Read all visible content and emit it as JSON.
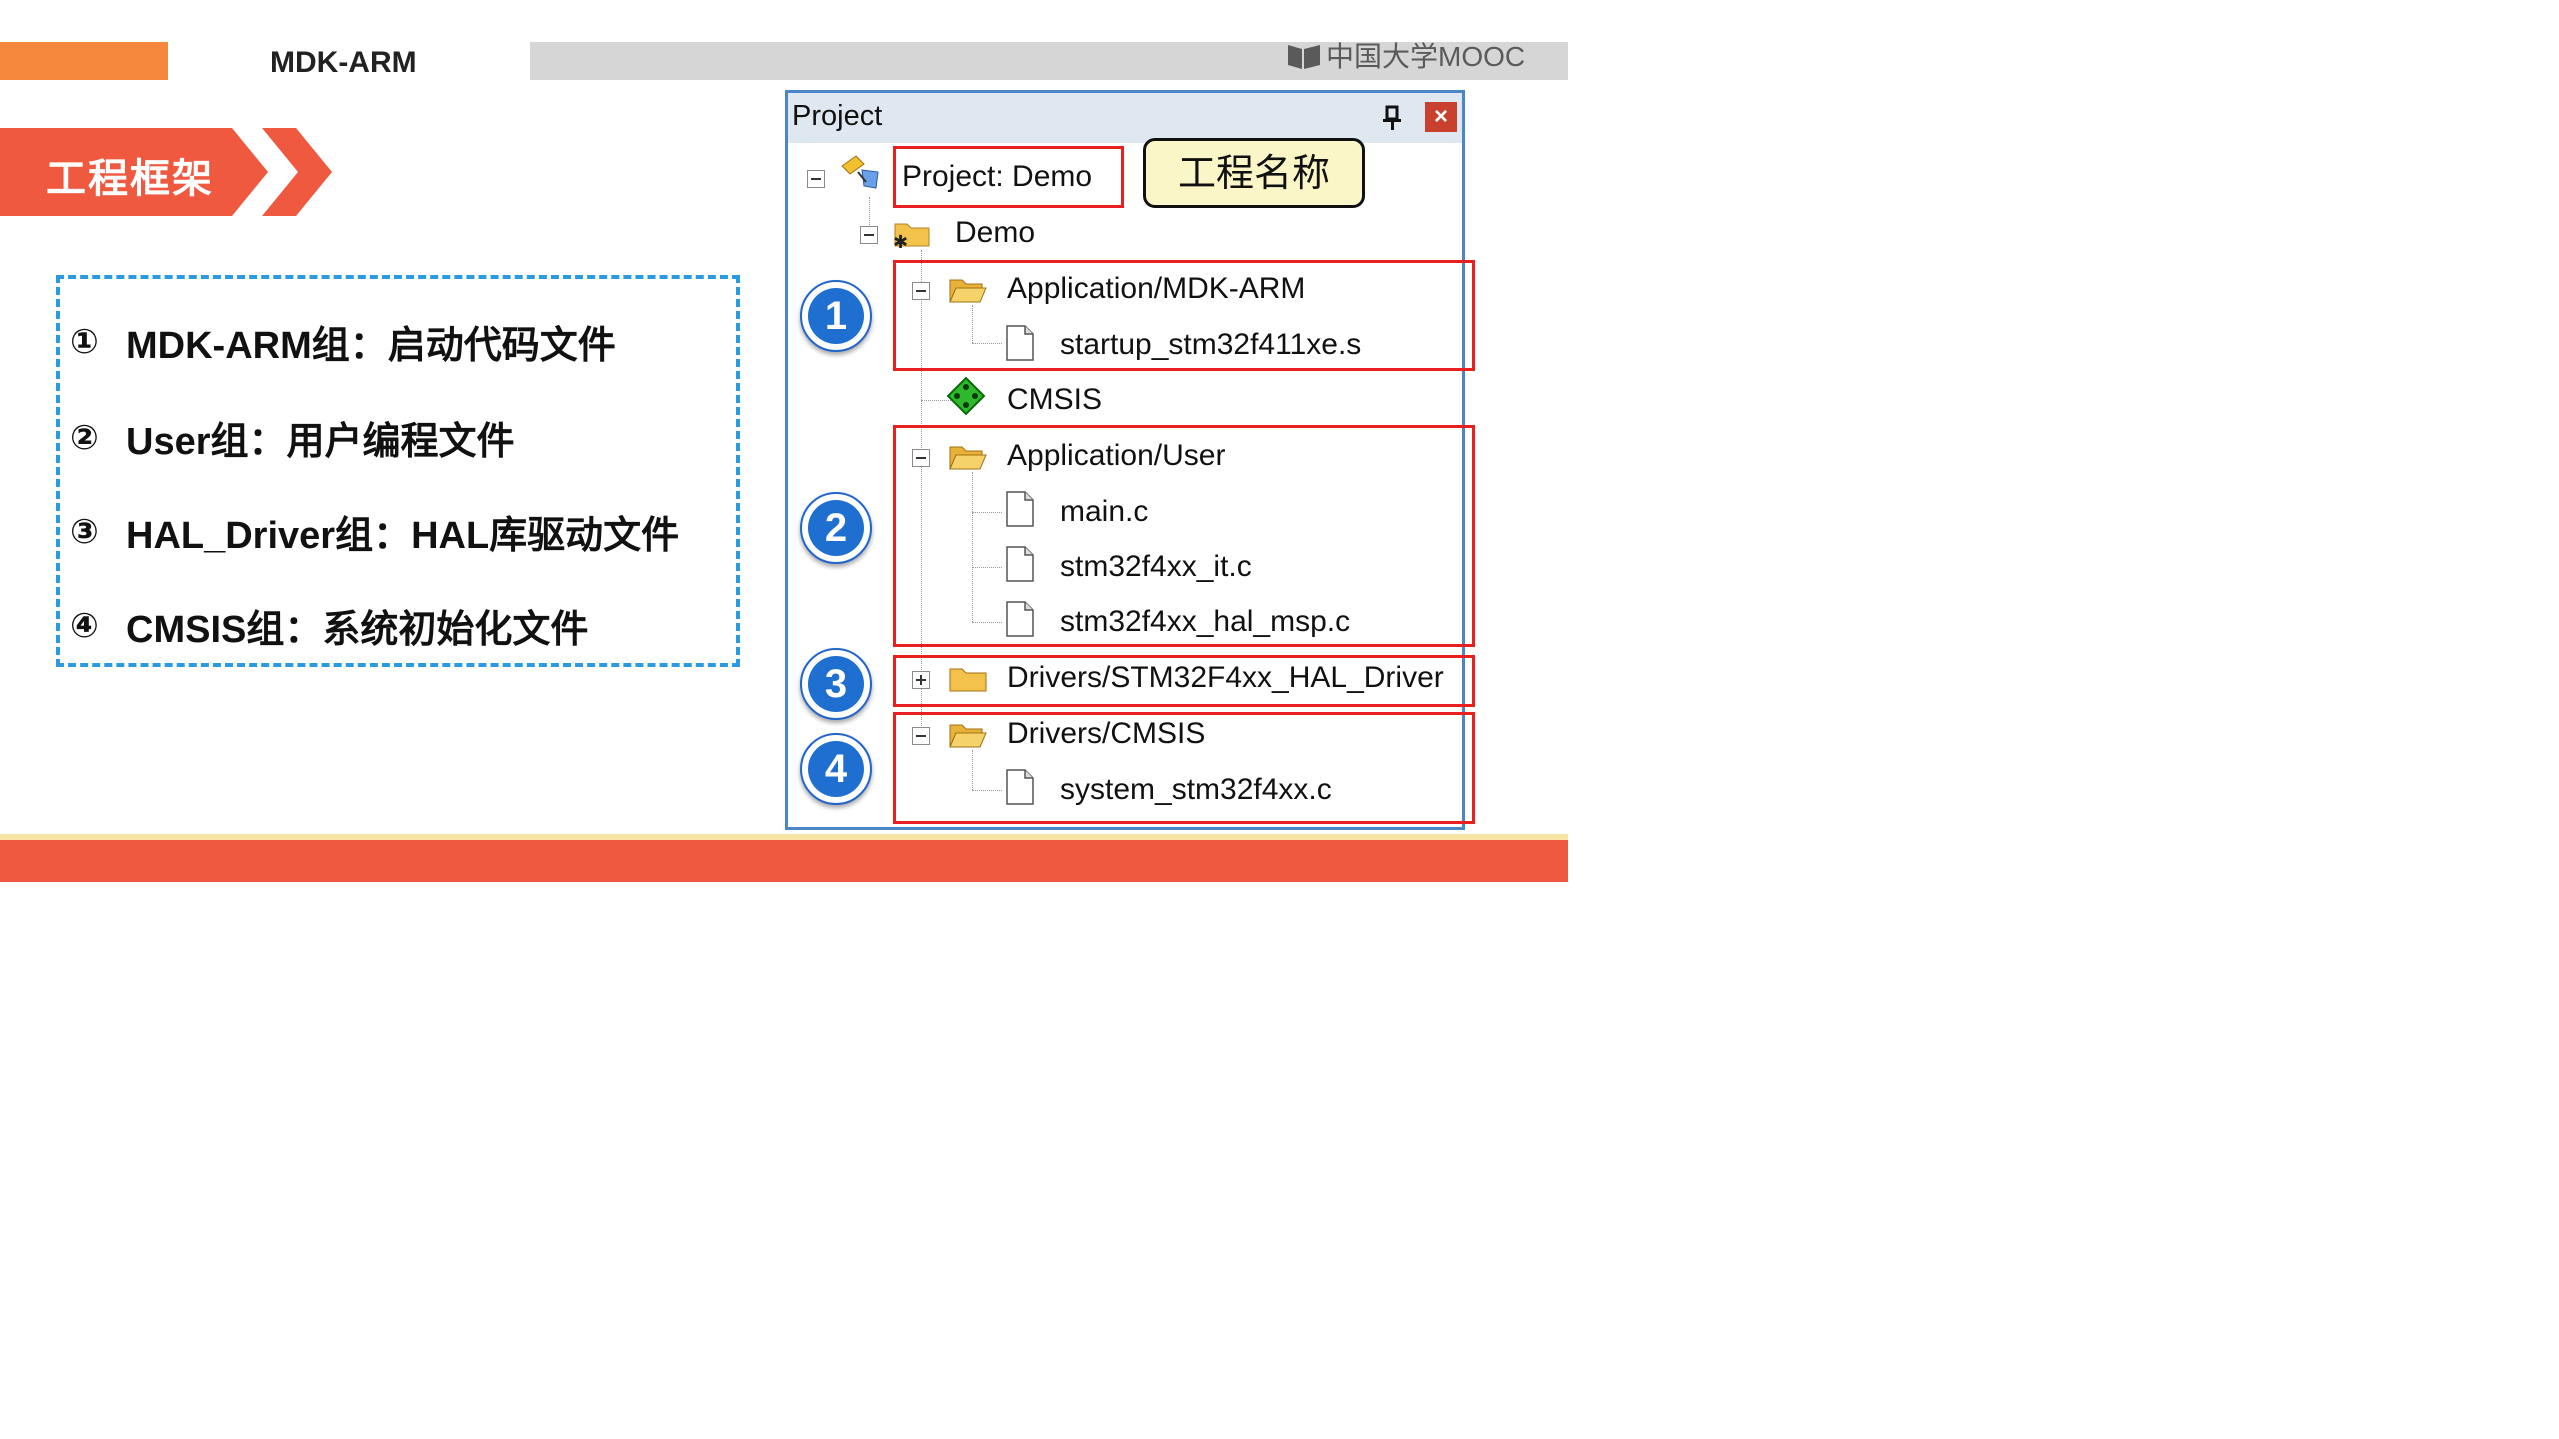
{
  "header": {
    "title": "MDK-ARM",
    "logo_text": "中国大学MOOC"
  },
  "section": {
    "title": "工程框架"
  },
  "items": [
    {
      "num": "①",
      "text": "MDK-ARM组：启动代码文件"
    },
    {
      "num": "②",
      "text": "User组：用户编程文件"
    },
    {
      "num": "③",
      "text": "HAL_Driver组：HAL库驱动文件"
    },
    {
      "num": "④",
      "text": "CMSIS组：系统初始化文件"
    }
  ],
  "project": {
    "panel_title": "Project",
    "close_label": "×",
    "callout": "工程名称",
    "tree": {
      "root": "Project: Demo",
      "target": "Demo",
      "groups": {
        "mdk": {
          "label": "Application/MDK-ARM",
          "files": [
            "startup_stm32f411xe.s"
          ]
        },
        "cmsis": {
          "label": "CMSIS"
        },
        "user": {
          "label": "Application/User",
          "files": [
            "main.c",
            "stm32f4xx_it.c",
            "stm32f4xx_hal_msp.c"
          ]
        },
        "hal": {
          "label": "Drivers/STM32F4xx_HAL_Driver"
        },
        "drv_cmsis": {
          "label": "Drivers/CMSIS",
          "files": [
            "system_stm32f4xx.c"
          ]
        }
      }
    },
    "badges": [
      "1",
      "2",
      "3",
      "4"
    ]
  },
  "colors": {
    "accent_orange": "#f4873b",
    "banner_red": "#ef5940",
    "highlight_red": "#e82020",
    "badge_blue": "#1f6fd0",
    "dash_blue": "#2a9be0"
  }
}
